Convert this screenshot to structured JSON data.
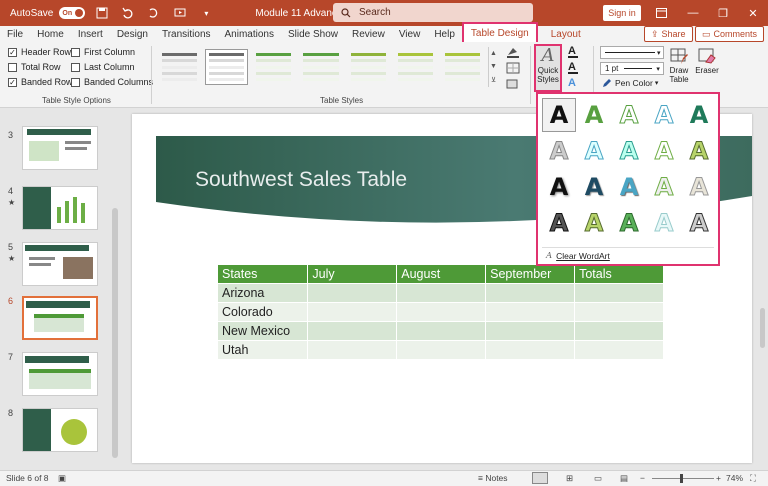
{
  "titlebar": {
    "autosave_label": "AutoSave",
    "autosave_state": "On",
    "doc_title": "Module 11 Advance... - Saved",
    "search_placeholder": "Search",
    "signin_label": "Sign in",
    "minimize": "—",
    "restore": "❐",
    "close": "✕"
  },
  "tabs": [
    {
      "label": "File"
    },
    {
      "label": "Home"
    },
    {
      "label": "Insert"
    },
    {
      "label": "Design"
    },
    {
      "label": "Transitions"
    },
    {
      "label": "Animations"
    },
    {
      "label": "Slide Show"
    },
    {
      "label": "Review"
    },
    {
      "label": "View"
    },
    {
      "label": "Help"
    },
    {
      "label": "Table Design"
    },
    {
      "label": "Layout"
    }
  ],
  "actions": {
    "share": "Share",
    "comments": "Comments"
  },
  "ribbon": {
    "options": {
      "header_row": "Header Row",
      "total_row": "Total Row",
      "banded_rows": "Banded Rows",
      "first_column": "First Column",
      "last_column": "Last Column",
      "banded_columns": "Banded Columns",
      "group_label": "Table Style Options"
    },
    "styles_group_label": "Table Styles",
    "quick_styles_label": "Quick Styles",
    "pen_weight": "1 pt",
    "pen_color_label": "Pen Color",
    "draw_table_label": "Draw Table",
    "eraser_label": "Eraser"
  },
  "table_style_colors": [
    "#6b6b6b",
    "#6b6b6b",
    "#58a040",
    "#58a040",
    "#8fb33a",
    "#a9c43b",
    "#a9c43b",
    "#58a040"
  ],
  "slides": [
    {
      "num": "3",
      "star": false
    },
    {
      "num": "4",
      "star": true
    },
    {
      "num": "5",
      "star": true
    },
    {
      "num": "6",
      "star": false
    },
    {
      "num": "7",
      "star": false
    },
    {
      "num": "8",
      "star": false
    }
  ],
  "slide": {
    "title": "Southwest Sales Table",
    "table": {
      "headers": [
        "States",
        "July",
        "August",
        "September",
        "Totals"
      ],
      "rows": [
        [
          "Arizona",
          "",
          "",
          "",
          ""
        ],
        [
          "Colorado",
          "",
          "",
          "",
          ""
        ],
        [
          "New Mexico",
          "",
          "",
          "",
          ""
        ],
        [
          "Utah",
          "",
          "",
          "",
          ""
        ]
      ]
    }
  },
  "wordart": {
    "glyph": "A",
    "clear_label": "Clear WordArt"
  },
  "status": {
    "slide_info": "Slide 6 of 8",
    "notes_label": "Notes",
    "zoom": "74%"
  }
}
